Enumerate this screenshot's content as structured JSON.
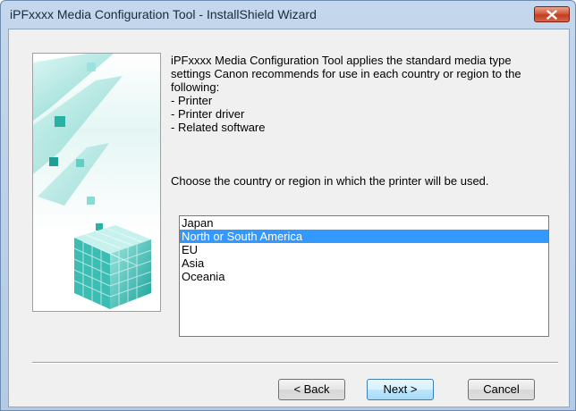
{
  "window": {
    "title": "iPFxxxx Media Configuration Tool - InstallShield Wizard",
    "close_icon": "close-icon",
    "accent_color": "#3399ff"
  },
  "description": {
    "lines": [
      "iPFxxxx Media Configuration Tool applies the standard media type",
      "settings Canon recommends for use in each country or region to the",
      "following:",
      "- Printer",
      "- Printer driver",
      "- Related software"
    ]
  },
  "prompt": "Choose the country or region in which the printer will be used.",
  "regions": [
    {
      "label": "Japan",
      "selected": false
    },
    {
      "label": "North or South America",
      "selected": true
    },
    {
      "label": "EU",
      "selected": false
    },
    {
      "label": "Asia",
      "selected": false
    },
    {
      "label": "Oceania",
      "selected": false
    }
  ],
  "buttons": {
    "back": "< Back",
    "next": "Next >",
    "cancel": "Cancel"
  }
}
